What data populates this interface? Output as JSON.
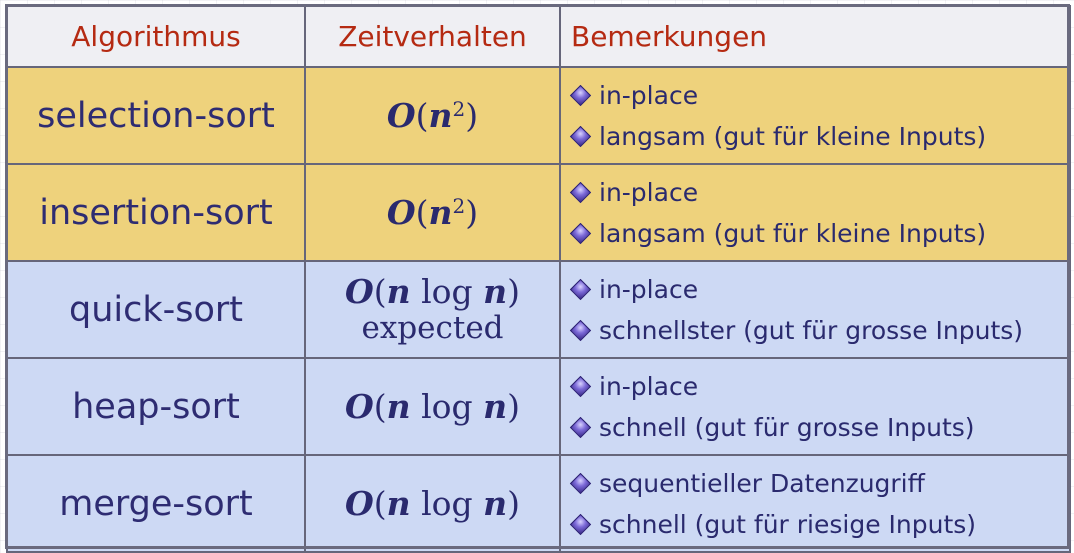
{
  "header": {
    "col_algorithm": "Algorithmus",
    "col_time": "Zeitverhalten",
    "col_notes": "Bemerkungen"
  },
  "colors": {
    "header_text": "#b52a12",
    "header_bg": "#efeff3",
    "quadratic_row_bg": "#eed27c",
    "nlogn_row_bg": "#cdd9f4",
    "body_text": "#2a2a6e",
    "border": "#66667a"
  },
  "rows": [
    {
      "algorithm": "selection-sort",
      "time": {
        "O": "O",
        "open": "(",
        "n": "n",
        "exp": "2",
        "close": ")"
      },
      "notes": [
        "in-place",
        "langsam (gut für kleine Inputs)"
      ],
      "notes_icon": "diamond-bullet-icon"
    },
    {
      "algorithm": "insertion-sort",
      "time": {
        "O": "O",
        "open": "(",
        "n": "n",
        "exp": "2",
        "close": ")"
      },
      "notes": [
        "in-place",
        "langsam (gut für kleine Inputs)"
      ],
      "notes_icon": "diamond-bullet-icon"
    },
    {
      "algorithm": "quick-sort",
      "time": {
        "O": "O",
        "open": "(",
        "n": "n",
        "log": " log ",
        "n2": "n",
        "close": ")",
        "qualifier": "expected"
      },
      "notes": [
        "in-place",
        "schnellster (gut für grosse Inputs)"
      ],
      "notes_icon": "diamond-bullet-icon"
    },
    {
      "algorithm": "heap-sort",
      "time": {
        "O": "O",
        "open": "(",
        "n": "n",
        "log": " log ",
        "n2": "n",
        "close": ")"
      },
      "notes": [
        "in-place",
        "schnell (gut für grosse Inputs)"
      ],
      "notes_icon": "diamond-bullet-icon"
    },
    {
      "algorithm": "merge-sort",
      "time": {
        "O": "O",
        "open": "(",
        "n": "n",
        "log": " log ",
        "n2": "n",
        "close": ")"
      },
      "notes": [
        "sequentieller Datenzugriff",
        "schnell (gut für riesige Inputs)"
      ],
      "notes_icon": "diamond-bullet-icon"
    }
  ]
}
